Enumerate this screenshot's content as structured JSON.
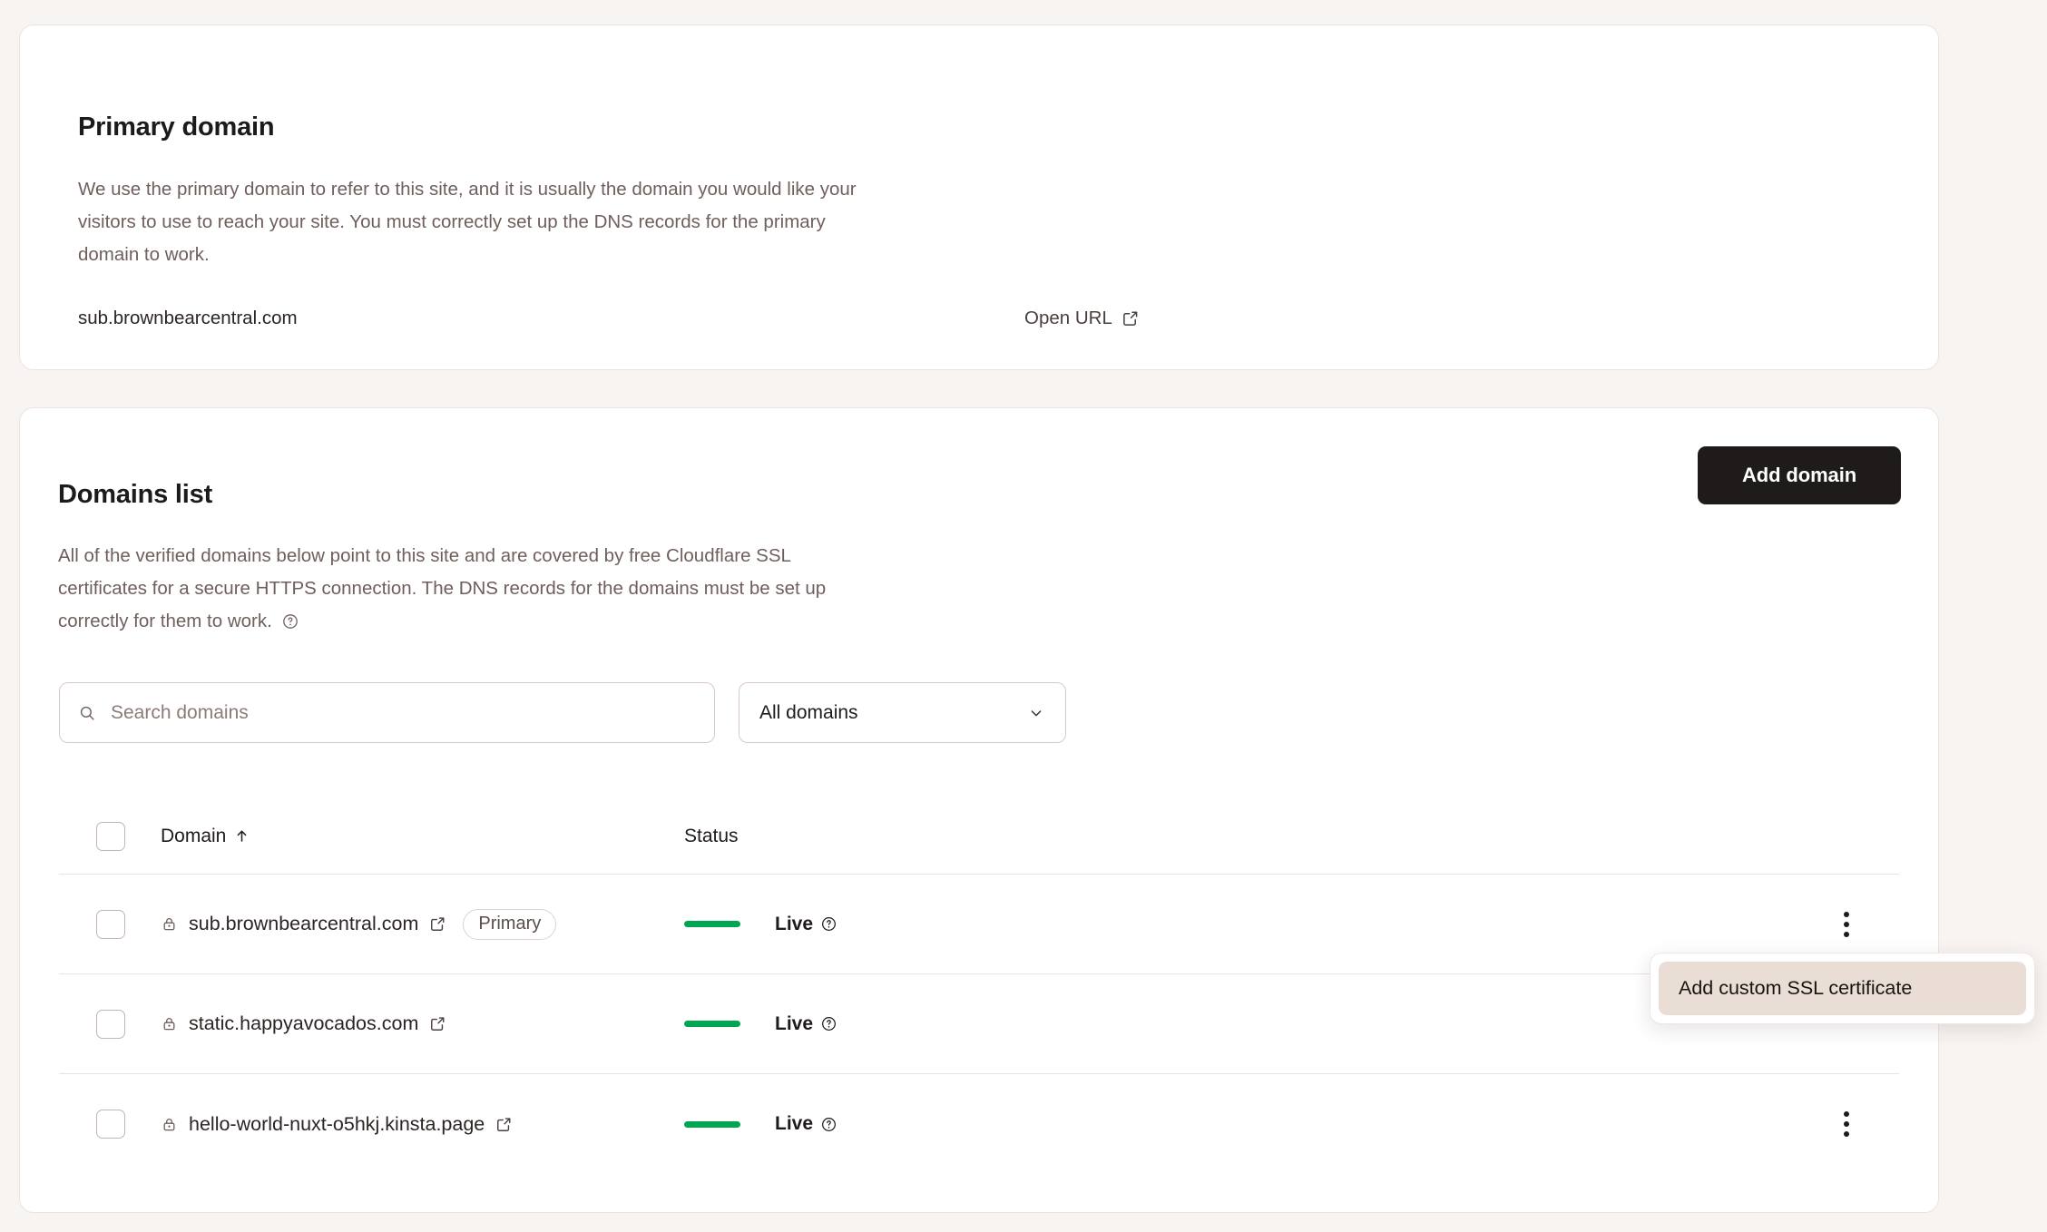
{
  "theme": {
    "page_bg": "#f8f4f2",
    "card_bg": "#ffffff",
    "card_border": "#ece3df",
    "accent_dark": "#1f1b1a",
    "muted_text": "#6f5f5c",
    "status_live": "#00a651",
    "menu_highlight": "#e9ddd6"
  },
  "primary_card": {
    "title": "Primary domain",
    "description": "We use the primary domain to refer to this site, and it is usually the domain you would like your visitors to use to reach your site. You must correctly set up the DNS records for the primary domain to work.",
    "domain": "sub.brownbearcentral.com",
    "open_url_label": "Open URL",
    "open_url_icon": "external-link-icon"
  },
  "domains_card": {
    "title": "Domains list",
    "description": "All of the verified domains below point to this site and are covered by free Cloudflare SSL certificates for a secure HTTPS connection. The DNS records for the domains must be set up correctly for them to work.",
    "description_help_icon": "help-circle-icon",
    "add_domain_label": "Add domain",
    "search": {
      "placeholder": "Search domains",
      "value": "",
      "icon": "search-icon"
    },
    "filter": {
      "selected": "All domains",
      "icon": "chevron-down-icon"
    },
    "table": {
      "columns": [
        {
          "label": "Domain",
          "sort": "ascending",
          "sort_icon": "arrow-up-icon"
        },
        {
          "label": "Status"
        }
      ],
      "select_all_checked": false,
      "rows": [
        {
          "checked": false,
          "lock_icon": "lock-icon",
          "domain": "sub.brownbearcentral.com",
          "link_icon": "external-link-icon",
          "badge": "Primary",
          "status": "Live",
          "status_help_icon": "help-circle-icon",
          "menu_icon": "kebab-menu-icon",
          "menu_open": false
        },
        {
          "checked": false,
          "lock_icon": "lock-icon",
          "domain": "static.happyavocados.com",
          "link_icon": "external-link-icon",
          "badge": "",
          "status": "Live",
          "status_help_icon": "help-circle-icon",
          "menu_icon": "kebab-menu-icon",
          "menu_open": true
        },
        {
          "checked": false,
          "lock_icon": "lock-icon",
          "domain": "hello-world-nuxt-o5hkj.kinsta.page",
          "link_icon": "external-link-icon",
          "badge": "",
          "status": "Live",
          "status_help_icon": "help-circle-icon",
          "menu_icon": "kebab-menu-icon",
          "menu_open": false
        }
      ]
    },
    "context_menu": {
      "items": [
        {
          "label": "Add custom SSL certificate",
          "highlighted": true
        }
      ]
    }
  }
}
